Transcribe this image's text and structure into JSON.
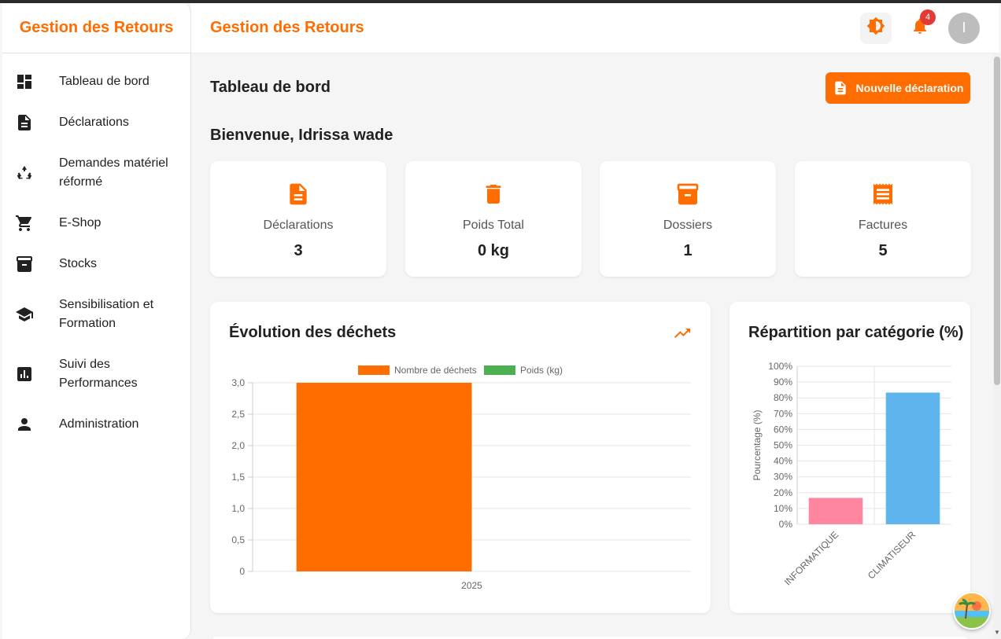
{
  "sidebar": {
    "brand": "Gestion des Retours",
    "items": [
      {
        "label": "Tableau de bord",
        "icon": "dashboard-icon"
      },
      {
        "label": "Déclarations",
        "icon": "document-icon"
      },
      {
        "label": "Demandes matériel réformé",
        "icon": "recycle-icon"
      },
      {
        "label": "E-Shop",
        "icon": "cart-icon"
      },
      {
        "label": "Stocks",
        "icon": "archive-icon"
      },
      {
        "label": "Sensibilisation et Formation",
        "icon": "school-icon"
      },
      {
        "label": "Suivi des Performances",
        "icon": "analytics-icon"
      },
      {
        "label": "Administration",
        "icon": "person-icon"
      }
    ]
  },
  "header": {
    "title": "Gestion des Retours",
    "notification_count": "4",
    "avatar_initial": "I"
  },
  "main": {
    "page_title": "Tableau de bord",
    "new_button_label": "Nouvelle déclaration",
    "welcome": "Bienvenue, Idrissa wade",
    "stats": [
      {
        "label": "Déclarations",
        "value": "3",
        "icon": "document-icon"
      },
      {
        "label": "Poids Total",
        "value": "0 kg",
        "icon": "trash-icon"
      },
      {
        "label": "Dossiers",
        "value": "1",
        "icon": "archive-icon"
      },
      {
        "label": "Factures",
        "value": "5",
        "icon": "receipt-icon"
      }
    ]
  },
  "colors": {
    "accent": "#ff6d00",
    "green": "#4caf50",
    "pink": "#ff869f",
    "blue": "#5eb5ee"
  },
  "chart_data": [
    {
      "type": "bar",
      "title": "Évolution des déchets",
      "categories": [
        "2025"
      ],
      "series": [
        {
          "name": "Nombre de déchets",
          "values": [
            3
          ],
          "color": "#ff6d00"
        },
        {
          "name": "Poids (kg)",
          "values": [
            0
          ],
          "color": "#4caf50"
        }
      ],
      "yticks": [
        "0",
        "0,5",
        "1,0",
        "1,5",
        "2,0",
        "2,5",
        "3,0"
      ],
      "ylim": [
        0,
        3
      ],
      "legend": "top",
      "grid": true
    },
    {
      "type": "bar",
      "title": "Répartition par catégorie (%)",
      "categories": [
        "INFORMATIQUE",
        "CLIMATISEUR"
      ],
      "values": [
        16.67,
        83.33
      ],
      "colors": [
        "#ff869f",
        "#5eb5ee"
      ],
      "ylabel": "Pourcentage (%)",
      "yticks": [
        "0%",
        "10%",
        "20%",
        "30%",
        "40%",
        "50%",
        "60%",
        "70%",
        "80%",
        "90%",
        "100%"
      ],
      "ylim": [
        0,
        100
      ],
      "grid": true
    }
  ]
}
